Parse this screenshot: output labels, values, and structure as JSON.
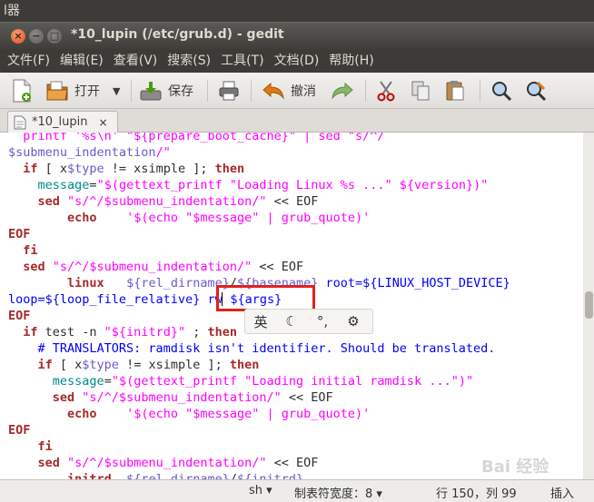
{
  "desktop": {
    "top_label": "l器"
  },
  "window": {
    "title": "*10_lupin (/etc/grub.d) - gedit"
  },
  "menu": [
    "文件(F)",
    "编辑(E)",
    "查看(V)",
    "搜索(S)",
    "工具(T)",
    "文档(D)",
    "帮助(H)"
  ],
  "toolbar": {
    "open_label": "打开",
    "save_label": "保存",
    "undo_label": "撤消"
  },
  "tab": {
    "label": "*10_lupin",
    "close": "×"
  },
  "editor": {
    "lines": [
      [
        [
          "s",
          "  printf '%s\\n' \"${prepare_boot_cache}\" | sed \"s/^/"
        ]
      ],
      [
        [
          "v",
          "$submenu_indentation"
        ],
        [
          "s",
          "/\""
        ]
      ],
      [
        [
          "k",
          "  if"
        ],
        [
          "p",
          " [ x"
        ],
        [
          "v",
          "$type"
        ],
        [
          "p",
          " != xsimple ]; "
        ],
        [
          "k",
          "then"
        ]
      ],
      [
        [
          "p",
          "    "
        ],
        [
          "vs",
          "message"
        ],
        [
          "p",
          "="
        ],
        [
          "s",
          "\"$(gettext_printf \"Loading Linux %s ...\" ${version})\""
        ]
      ],
      [
        [
          "k",
          "    sed"
        ],
        [
          "p",
          " "
        ],
        [
          "s",
          "\"s/^/$submenu_indentation/\""
        ],
        [
          "p",
          " << EOF"
        ]
      ],
      [
        [
          "k",
          "        echo"
        ],
        [
          "p",
          "    "
        ],
        [
          "s",
          "'$(echo \"$message\" | grub_quote)'"
        ]
      ],
      [
        [
          "k",
          "EOF"
        ]
      ],
      [
        [
          "k",
          "  fi"
        ]
      ],
      [
        [
          "k",
          "  sed"
        ],
        [
          "p",
          " "
        ],
        [
          "s",
          "\"s/^/$submenu_indentation/\""
        ],
        [
          "p",
          " << EOF"
        ]
      ],
      [
        [
          "k",
          "        linux"
        ],
        [
          "p",
          "   "
        ],
        [
          "v",
          "${rel_dirname}"
        ],
        [
          "p",
          "/"
        ],
        [
          "v",
          "${basename}"
        ],
        [
          "p",
          " "
        ],
        [
          "c",
          "root=${LINUX_HOST_DEVICE}"
        ]
      ],
      [
        [
          "c",
          "loop=${loop_file_relative}"
        ],
        [
          "p",
          " "
        ],
        [
          "c",
          "rw"
        ],
        [
          "cursor",
          ""
        ],
        [
          "p",
          " "
        ],
        [
          "c",
          "${args}"
        ]
      ],
      [
        [
          "k",
          "EOF"
        ]
      ],
      [
        [
          "k",
          "  if"
        ],
        [
          "p",
          " test -n "
        ],
        [
          "s",
          "\"${initrd}\""
        ],
        [
          "p",
          " ; "
        ],
        [
          "k",
          "then"
        ]
      ],
      [
        [
          "c",
          "    # TRANSLATORS: ramdisk isn't identifier. Should be translated."
        ]
      ],
      [
        [
          "k",
          "    if"
        ],
        [
          "p",
          " [ x"
        ],
        [
          "v",
          "$type"
        ],
        [
          "p",
          " != xsimple ]; "
        ],
        [
          "k",
          "then"
        ]
      ],
      [
        [
          "p",
          "      "
        ],
        [
          "vs",
          "message"
        ],
        [
          "p",
          "="
        ],
        [
          "s",
          "\"$(gettext_printf \"Loading initial ramdisk ...\")\""
        ]
      ],
      [
        [
          "k",
          "      sed"
        ],
        [
          "p",
          " "
        ],
        [
          "s",
          "\"s/^/$submenu_indentation/\""
        ],
        [
          "p",
          " << EOF"
        ]
      ],
      [
        [
          "k",
          "        echo"
        ],
        [
          "p",
          "    "
        ],
        [
          "s",
          "'$(echo \"$message\" | grub_quote)'"
        ]
      ],
      [
        [
          "k",
          "EOF"
        ]
      ],
      [
        [
          "k",
          "    fi"
        ]
      ],
      [
        [
          "k",
          "    sed"
        ],
        [
          "p",
          " "
        ],
        [
          "s",
          "\"s/^/$submenu_indentation/\""
        ],
        [
          "p",
          " << EOF"
        ]
      ],
      [
        [
          "k",
          "        initrd"
        ],
        [
          "p",
          "  "
        ],
        [
          "v",
          "${rel_dirname}"
        ],
        [
          "p",
          "/"
        ],
        [
          "v",
          "${initrd}"
        ]
      ]
    ]
  },
  "ime": {
    "mode": "英",
    "moon": "☾",
    "punct": "°,",
    "settings": "⚙"
  },
  "status": {
    "lang": "sh ▾",
    "tab_width": "制表符宽度：8 ▾",
    "position": "行 150，列 99",
    "mode": "插入"
  },
  "watermark": "Bai 经验"
}
